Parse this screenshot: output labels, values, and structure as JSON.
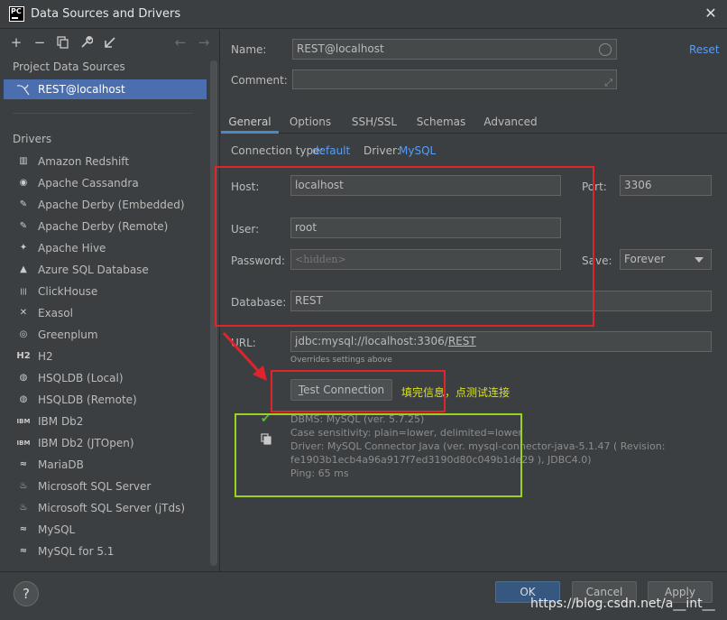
{
  "window": {
    "title": "Data Sources and Drivers",
    "logo_text": "PC",
    "close": "✕"
  },
  "toolbar": {
    "add": "+",
    "remove": "−",
    "back": "←",
    "forward": "→"
  },
  "left": {
    "project_sources_label": "Project Data Sources",
    "selected_source": "REST@localhost",
    "drivers_label": "Drivers",
    "drivers": [
      {
        "label": "Amazon Redshift",
        "icon": "redshift-icon",
        "glyph": "▥"
      },
      {
        "label": "Apache Cassandra",
        "icon": "cassandra-icon",
        "glyph": "◉"
      },
      {
        "label": "Apache Derby (Embedded)",
        "icon": "derby-icon",
        "glyph": "✎"
      },
      {
        "label": "Apache Derby (Remote)",
        "icon": "derby-icon",
        "glyph": "✎"
      },
      {
        "label": "Apache Hive",
        "icon": "hive-icon",
        "glyph": "✦"
      },
      {
        "label": "Azure SQL Database",
        "icon": "azure-icon",
        "glyph": "▲"
      },
      {
        "label": "ClickHouse",
        "icon": "clickhouse-icon",
        "glyph": "|||"
      },
      {
        "label": "Exasol",
        "icon": "exasol-icon",
        "glyph": "✕"
      },
      {
        "label": "Greenplum",
        "icon": "greenplum-icon",
        "glyph": "◎"
      },
      {
        "label": "H2",
        "icon": "h2-icon",
        "glyph": "H2"
      },
      {
        "label": "HSQLDB (Local)",
        "icon": "hsqldb-icon",
        "glyph": "◍"
      },
      {
        "label": "HSQLDB (Remote)",
        "icon": "hsqldb-icon",
        "glyph": "◍"
      },
      {
        "label": "IBM Db2",
        "icon": "ibm-db2-icon",
        "glyph": "IBM"
      },
      {
        "label": "IBM Db2 (JTOpen)",
        "icon": "ibm-db2-icon",
        "glyph": "IBM"
      },
      {
        "label": "MariaDB",
        "icon": "mariadb-icon",
        "glyph": "≈"
      },
      {
        "label": "Microsoft SQL Server",
        "icon": "sqlserver-icon",
        "glyph": "♨"
      },
      {
        "label": "Microsoft SQL Server (jTds)",
        "icon": "sqlserver-icon",
        "glyph": "♨"
      },
      {
        "label": "MySQL",
        "icon": "mysql-icon",
        "glyph": "≈"
      },
      {
        "label": "MySQL for 5.1",
        "icon": "mysql-icon",
        "glyph": "≈"
      }
    ]
  },
  "form": {
    "name_label": "Name:",
    "name_value": "REST@localhost",
    "reset_label": "Reset",
    "comment_label": "Comment:",
    "comment_value": "",
    "tabs": [
      "General",
      "Options",
      "SSH/SSL",
      "Schemas",
      "Advanced"
    ],
    "conn_type_label": "Connection type:",
    "conn_type_value": "default",
    "driver_label": "Driver:",
    "driver_value": "MySQL",
    "host_label": "Host:",
    "host_value": "localhost",
    "port_label": "Port:",
    "port_value": "3306",
    "user_label": "User:",
    "user_value": "root",
    "password_label": "Password:",
    "password_value": "<hidden>",
    "save_label": "Save:",
    "save_value": "Forever",
    "database_label": "Database:",
    "database_value": "REST",
    "url_label": "URL:",
    "url_prefix": "jdbc:mysql://localhost:3306/",
    "url_db": "REST",
    "url_hint": "Overrides settings above",
    "test_button_prefix": "",
    "test_button_ul": "T",
    "test_button_rest": "est Connection",
    "annotation_note": "填完信息，点测试连接"
  },
  "result": {
    "lines": [
      "DBMS: MySQL (ver. 5.7.25)",
      "Case sensitivity: plain=lower, delimited=lower",
      "Driver: MySQL Connector Java (ver. mysql-connector-java-5.1.47 ( Revision:",
      "fe1903b1ecb4a96a917f7ed3190d80c049b1de29 ), JDBC4.0)",
      "Ping: 65 ms"
    ]
  },
  "bottom": {
    "help": "?",
    "ok": "OK",
    "cancel": "Cancel",
    "apply": "Apply",
    "watermark": "https://blog.csdn.net/a__int__"
  },
  "colors": {
    "selection": "#4b6eaf",
    "link": "#589df6",
    "red_annotation": "#e0242b",
    "green_annotation": "#9bd21f",
    "success_check": "#62b543"
  }
}
